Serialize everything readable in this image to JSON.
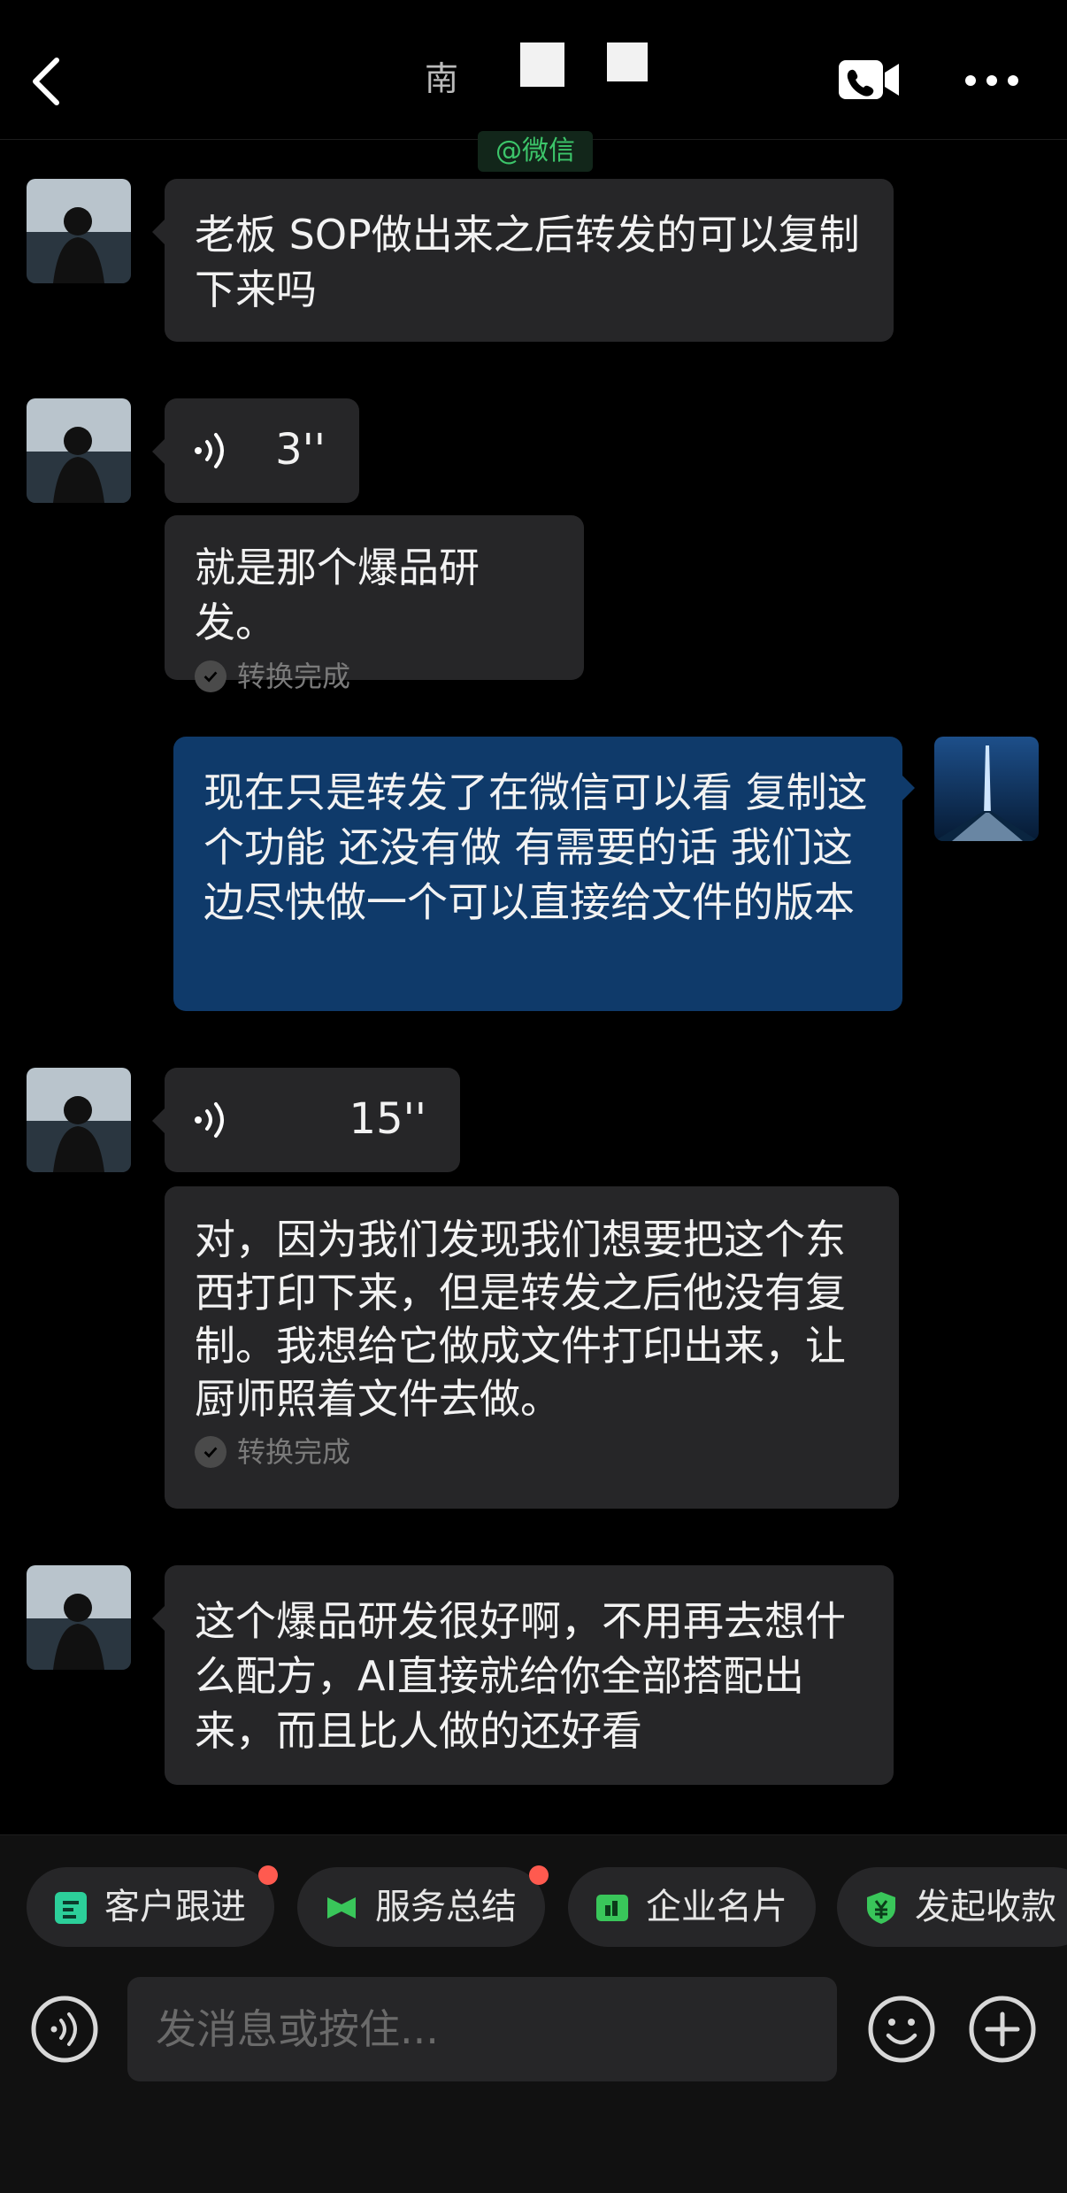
{
  "header": {
    "title_visible_char": "南",
    "org_tag": "@微信",
    "icons": [
      "back-chevron-icon",
      "video-call-icon",
      "more-icon"
    ]
  },
  "messages": [
    {
      "type": "text",
      "side": "in",
      "text": "老板 SOP做出来之后转发的可以复制下来吗"
    },
    {
      "type": "voice",
      "side": "in",
      "duration": "3''"
    },
    {
      "type": "transcript",
      "side": "in",
      "text": "就是那个爆品研发。",
      "status": "转换完成"
    },
    {
      "type": "text",
      "side": "out",
      "text": "现在只是转发了在微信可以看 复制这个功能 还没有做 有需要的话 我们这边尽快做一个可以直接给文件的版本"
    },
    {
      "type": "voice",
      "side": "in",
      "duration": "15''"
    },
    {
      "type": "transcript",
      "side": "in",
      "text": "对，因为我们发现我们想要把这个东西打印下来，但是转发之后他没有复制。我想给它做成文件打印出来，让厨师照着文件去做。",
      "status": "转换完成"
    },
    {
      "type": "text",
      "side": "in",
      "text": "这个爆品研发很好啊，不用再去想什么配方，AI直接就给你全部搭配出来，而且比人做的还好看"
    }
  ],
  "quick_actions": [
    {
      "label": "客户跟进",
      "badge": true,
      "icon": "customer-follow-icon"
    },
    {
      "label": "服务总结",
      "badge": true,
      "icon": "service-summary-icon"
    },
    {
      "label": "企业名片",
      "badge": false,
      "icon": "business-card-icon"
    },
    {
      "label": "发起收款",
      "badge": false,
      "icon": "payment-icon"
    }
  ],
  "input": {
    "placeholder": "发消息或按住..."
  },
  "colors": {
    "background": "#000000",
    "bubble_in": "#262628",
    "bubble_out": "#0f3a6a",
    "tag_green": "#3cc56a",
    "badge_red": "#ff5a4f"
  }
}
